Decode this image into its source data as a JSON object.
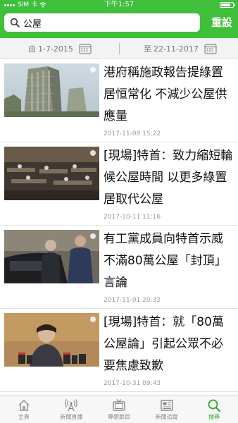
{
  "status_bar": {
    "carrier": "SIM 卡",
    "time": "下午1:57"
  },
  "search": {
    "query": "公屋",
    "reset_label": "重設"
  },
  "date_filter": {
    "from_prefix": "由",
    "from_date": "1-7-2015",
    "to_prefix": "至",
    "to_date": "22-11-2017"
  },
  "articles": [
    {
      "headline": "港府稱施政報告提綠置居恒常化 不減少公屋供應量",
      "time": "2017-11-08 15:22"
    },
    {
      "headline": "[現場]特首：致力縮短輪候公屋時間 以更多綠置居取代公屋",
      "time": "2017-10-11 11:16"
    },
    {
      "headline": "有工黨成員向特首示威 不滿80萬公屋「封頂」言論",
      "time": "2017-11-01 20:32"
    },
    {
      "headline": "[現場]特首：就「80萬公屋論」引起公眾不必要焦慮致歉",
      "time": "2017-10-31 09:43"
    }
  ],
  "tabs": [
    {
      "label": "主頁",
      "icon": "home-icon"
    },
    {
      "label": "新聞直播",
      "icon": "broadcast-icon"
    },
    {
      "label": "專題節目",
      "icon": "tv-icon"
    },
    {
      "label": "新聞追蹤",
      "icon": "newspaper-icon"
    },
    {
      "label": "搜尋",
      "icon": "search-icon",
      "active": true
    }
  ],
  "colors": {
    "brand_green": "#3fbf3a",
    "active_tab": "#2ea82a"
  }
}
